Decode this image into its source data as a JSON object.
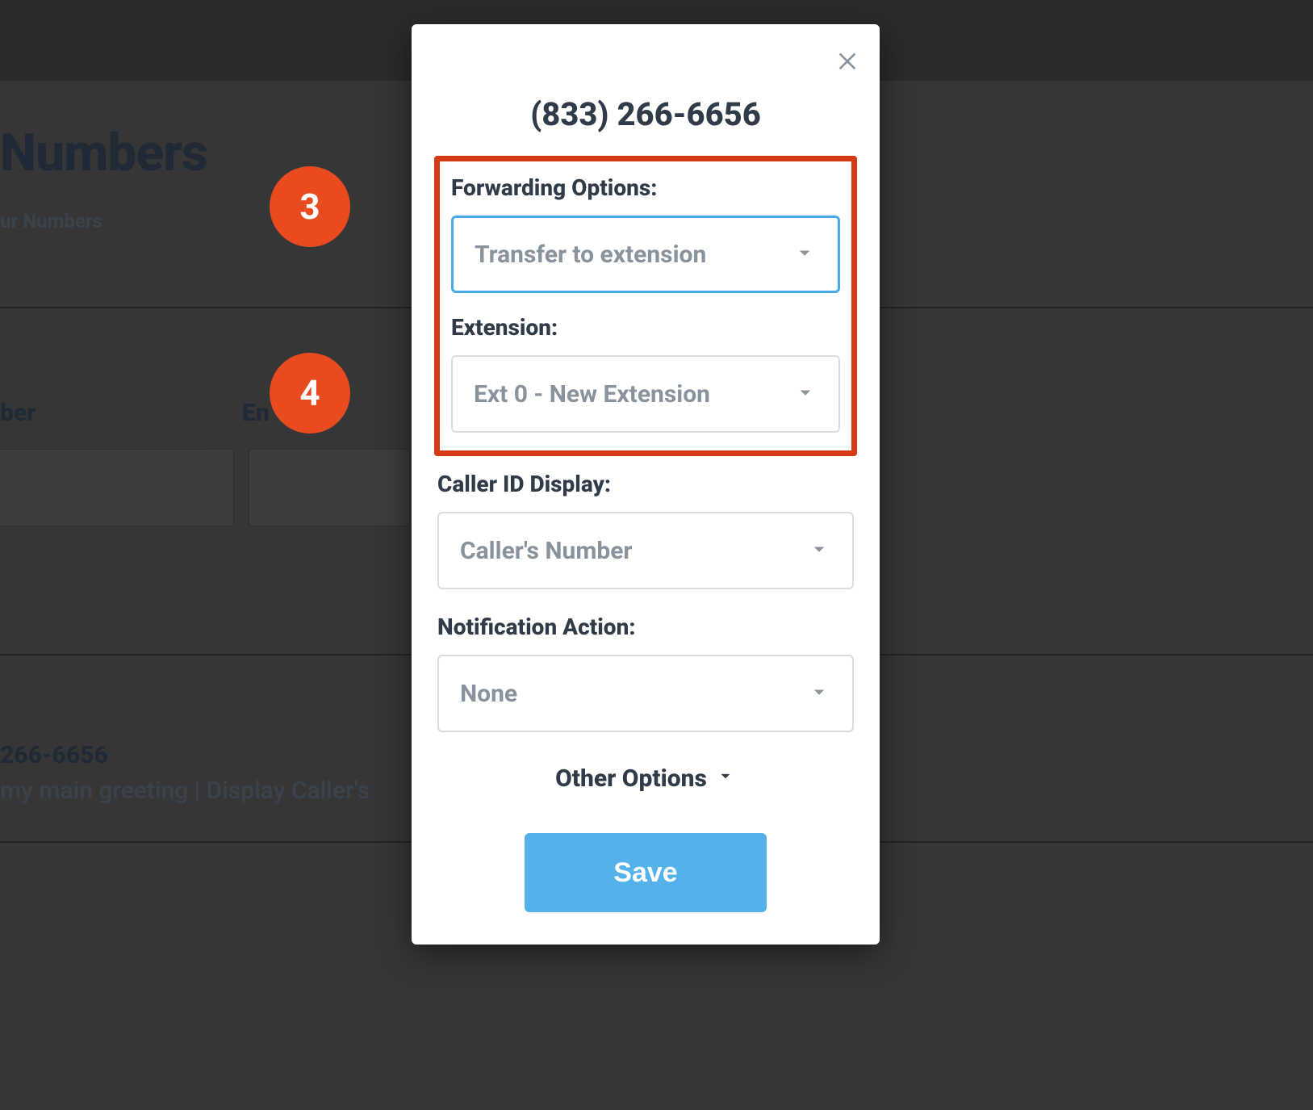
{
  "background": {
    "title_fragment": "Numbers",
    "subtitle_fragment": "ur Numbers",
    "col1_fragment": "ber",
    "col2_fragment": "En",
    "phone_fragment": "266-6656",
    "desc_fragment": "my main greeting | Display Caller's"
  },
  "steps": {
    "step3": "3",
    "step4": "4"
  },
  "modal": {
    "title": "(833) 266-6656",
    "forwarding_label": "Forwarding Options:",
    "forwarding_value": "Transfer to extension",
    "extension_label": "Extension:",
    "extension_value": "Ext 0 - New Extension",
    "caller_id_label": "Caller ID Display:",
    "caller_id_value": "Caller's Number",
    "notification_label": "Notification Action:",
    "notification_value": "None",
    "other_options": "Other Options",
    "save": "Save"
  }
}
